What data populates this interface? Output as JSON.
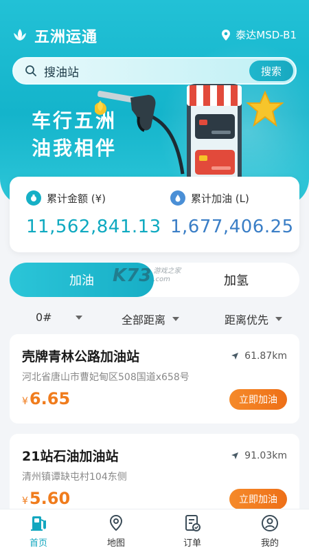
{
  "app": {
    "name": "五洲运通"
  },
  "location": {
    "text": "泰达MSD-B1"
  },
  "search": {
    "placeholder": "搜油站",
    "button_label": "搜索"
  },
  "banner": {
    "line1": "车行五洲",
    "line2": "油我相伴"
  },
  "stats": {
    "total_amount_label": "累计金额 (¥)",
    "total_amount_value": "11,562,841.13",
    "total_fuel_label": "累计加油 (L)",
    "total_fuel_value": "1,677,406.25"
  },
  "fuel_toggle": {
    "active": "加油",
    "inactive": "加氢"
  },
  "watermark": {
    "big": "K73",
    "line1": "游戏之家",
    "line2": ".com"
  },
  "filters": {
    "fuel_grade": "0#",
    "distance_range": "全部距离",
    "sort": "距离优先"
  },
  "stations": [
    {
      "name": "壳牌青林公路加油站",
      "distance": "61.87km",
      "address": "河北省唐山市曹妃甸区508国道x658号",
      "currency": "¥",
      "price": "6.65",
      "action": "立即加油"
    },
    {
      "name": "21站石油加油站",
      "distance": "91.03km",
      "address": "清州镇谭缺屯村104东侧",
      "currency": "¥",
      "price": "5.60",
      "action": "立即加油"
    }
  ],
  "tabbar": {
    "items": [
      {
        "label": "首页"
      },
      {
        "label": "地图"
      },
      {
        "label": "订单"
      },
      {
        "label": "我的"
      }
    ],
    "active_index": 0
  },
  "colors": {
    "brand": "#17b2c9",
    "accent_orange": "#f07c1d",
    "active_tab": "#13a7bf"
  }
}
